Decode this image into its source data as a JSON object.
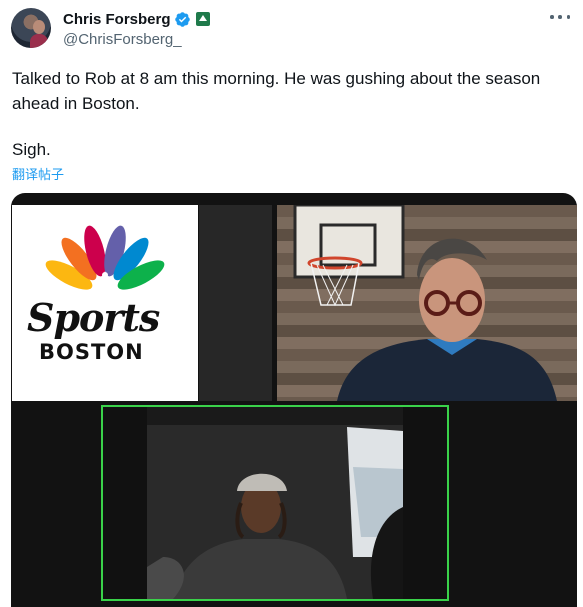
{
  "tweet": {
    "author": {
      "display_name": "Chris Forsberg",
      "handle": "@ChrisForsberg_",
      "verified": true,
      "affiliate_badge": "celtics-affiliate-badge"
    },
    "text_line": "Talked to Rob at 8 am this morning. He was gushing about the season ahead in Boston.",
    "text_sigh": "Sigh.",
    "translate_label": "翻译帖子",
    "more_icon": "more-horizontal-icon"
  },
  "media": {
    "logo": {
      "brand_word": "Sports",
      "city_word": "BOSTON",
      "peacock_colors": [
        "#f37021",
        "#fcb711",
        "#cc004c",
        "#6460aa",
        "#0089d0",
        "#0db14b"
      ]
    }
  },
  "colors": {
    "link": "#1d9bf0",
    "verified": "#1d9bf0",
    "active_speaker_border": "#3ad24a"
  }
}
